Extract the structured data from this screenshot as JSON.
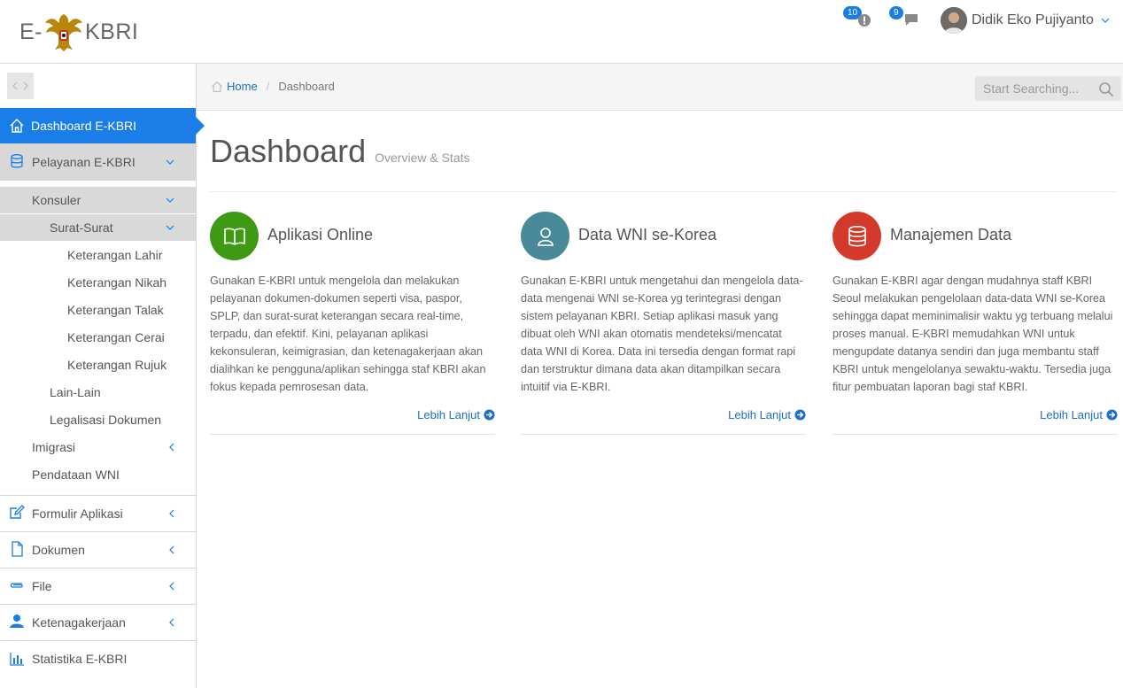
{
  "header": {
    "logo_prefix": "E-",
    "logo_suffix": "KBRI",
    "alerts_count": "10",
    "messages_count": "9",
    "user_name": "Didik Eko Pujiyanto"
  },
  "sidebar": {
    "dashboard": "Dashboard E-KBRI",
    "pelayanan": "Pelayanan E-KBRI",
    "konsuler": "Konsuler",
    "surat_surat": "Surat-Surat",
    "surat_items": [
      "Keterangan Lahir",
      "Keterangan Nikah",
      "Keterangan Talak",
      "Keterangan Cerai",
      "Keterangan Rujuk"
    ],
    "lain_lain": "Lain-Lain",
    "legalisasi": "Legalisasi Dokumen",
    "imigrasi": "Imigrasi",
    "pendataan": "Pendataan WNI",
    "formulir": "Formulir Aplikasi",
    "dokumen": "Dokumen",
    "file": "File",
    "ketenagakerjaan": "Ketenagakerjaan",
    "statistika": "Statistika E-KBRI"
  },
  "breadcrumb": {
    "home": "Home",
    "current": "Dashboard"
  },
  "search": {
    "placeholder": "Start Searching..."
  },
  "page": {
    "title": "Dashboard",
    "subtitle": "Overview & Stats"
  },
  "cards": [
    {
      "title": "Aplikasi Online",
      "icon": "book-icon",
      "color": "#3d9a12",
      "description": "Gunakan E-KBRI untuk mengelola dan melakukan pelayanan dokumen-dokumen seperti visa, paspor, SPLP, dan surat-surat keterangan secara real-time, terpadu, dan efektif. Kini, pelayanan aplikasi kekonsuleran, keimigrasian, dan ketenagakerjaan akan dialihkan ke pengguna/aplikan sehingga staf KBRI akan fokus kepada pemrosesan data.",
      "more": "Lebih Lanjut"
    },
    {
      "title": "Data WNI se-Korea",
      "icon": "user-icon",
      "color": "#4a8a98",
      "description": "Gunakan E-KBRI untuk mengetahui dan mengelola data-data mengenai WNI se-Korea yg terintegrasi dengan sistem pelayanan KBRI. Setiap aplikasi masuk yang dibuat oleh WNI akan otomatis mendeteksi/mencatat data WNI di Korea. Data ini tersedia dengan format rapi dan terstruktur dimana data akan ditampilkan secara intuitif via E-KBRI.",
      "more": "Lebih Lanjut"
    },
    {
      "title": "Manajemen Data",
      "icon": "database-icon",
      "color": "#d33a2c",
      "description": "Gunakan E-KBRI agar dengan mudahnya staff KBRI Seoul melakukan pengelolaan data-data WNI se-Korea sehingga dapat meminimalisir waktu yg terbuang melalui proses manual. E-KBRI memudahkan WNI untuk mengupdate datanya sendiri dan juga membantu staff KBRI untuk mengelolanya sewaktu-waktu. Tersedia juga fitur pembuatan laporan bagi staf KBRI.",
      "more": "Lebih Lanjut"
    }
  ]
}
